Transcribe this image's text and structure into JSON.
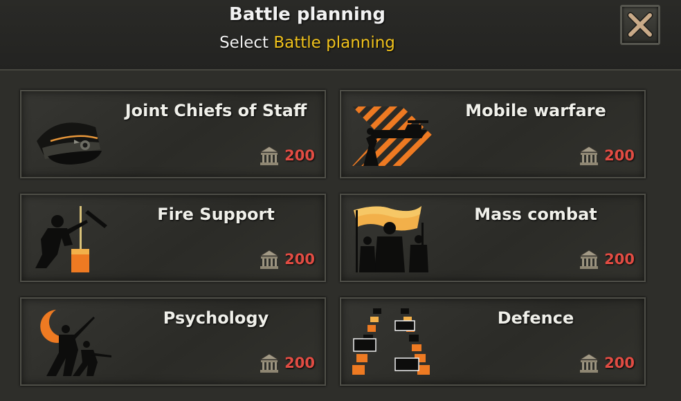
{
  "header": {
    "title": "Battle planning",
    "subtitle_prefix": "Select",
    "subtitle_highlight": "Battle planning"
  },
  "close_icon": "close-icon",
  "colors": {
    "highlight": "#f0c21c",
    "cost": "#e24c43",
    "accent_orange": "#ee7a22"
  },
  "doctrines": [
    {
      "name": "Joint Chiefs of Staff",
      "cost": "200",
      "icon": "officer-cap-icon"
    },
    {
      "name": "Mobile warfare",
      "cost": "200",
      "icon": "tank-chevron-icon"
    },
    {
      "name": "Fire Support",
      "cost": "200",
      "icon": "artillery-soldier-icon"
    },
    {
      "name": "Mass combat",
      "cost": "200",
      "icon": "crowd-flag-icon"
    },
    {
      "name": "Psychology",
      "cost": "200",
      "icon": "moon-soldiers-icon"
    },
    {
      "name": "Defence",
      "cost": "200",
      "icon": "barrier-icon"
    }
  ],
  "cost_icon": "army-experience-icon"
}
